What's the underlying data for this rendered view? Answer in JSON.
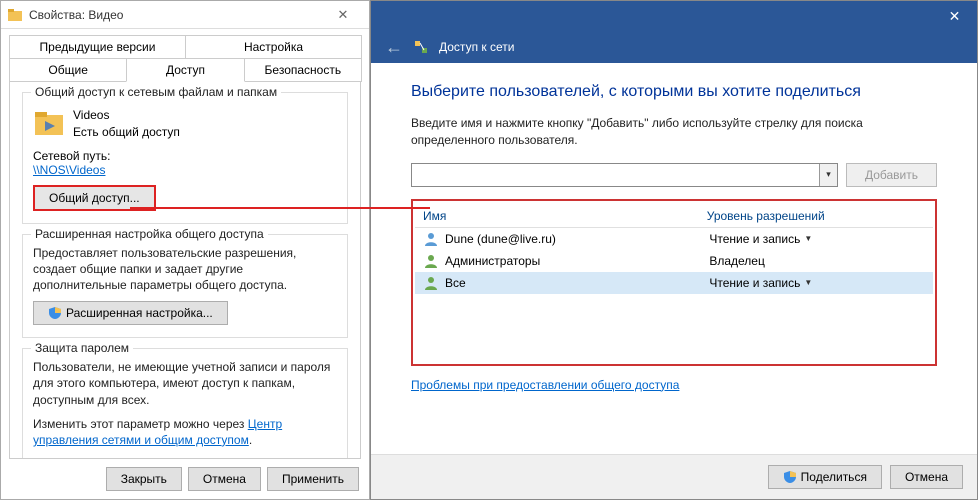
{
  "left": {
    "title": "Свойства: Видео",
    "tabs": {
      "prev": "Предыдущие версии",
      "setup": "Настройка",
      "general": "Общие",
      "access": "Доступ",
      "security": "Безопасность"
    },
    "group1": {
      "title": "Общий доступ к сетевым файлам и папкам",
      "folder_name": "Videos",
      "share_state": "Есть общий доступ",
      "net_path_label": "Сетевой путь:",
      "net_path": "\\\\NOS\\Videos",
      "share_btn": "Общий доступ..."
    },
    "group2": {
      "title": "Расширенная настройка общего доступа",
      "desc": "Предоставляет пользовательские разрешения, создает общие папки и задает другие дополнительные параметры общего доступа.",
      "btn": "Расширенная настройка..."
    },
    "group3": {
      "title": "Защита паролем",
      "desc": "Пользователи, не имеющие учетной записи и пароля для этого компьютера, имеют доступ к папкам, доступным для всех.",
      "desc2_pre": "Изменить этот параметр можно через ",
      "link": "Центр управления сетями и общим доступом",
      "desc2_post": "."
    },
    "buttons": {
      "close": "Закрыть",
      "cancel": "Отмена",
      "apply": "Применить"
    }
  },
  "right": {
    "header": "Доступ к сети",
    "title": "Выберите пользователей, с которыми вы хотите поделиться",
    "desc": "Введите имя и нажмите кнопку \"Добавить\" либо используйте стрелку для поиска определенного пользователя.",
    "add_btn": "Добавить",
    "table": {
      "col_name": "Имя",
      "col_perm": "Уровень разрешений",
      "rows": [
        {
          "name": "Dune  (dune@live.ru)",
          "perm": "Чтение и запись",
          "icon": "user",
          "drop": true
        },
        {
          "name": "Администраторы",
          "perm": "Владелец",
          "icon": "group",
          "drop": false
        },
        {
          "name": "Все",
          "perm": "Чтение и запись",
          "icon": "group",
          "drop": true,
          "selected": true
        }
      ]
    },
    "trouble": "Проблемы при предоставлении общего доступа",
    "buttons": {
      "share": "Поделиться",
      "cancel": "Отмена"
    }
  }
}
